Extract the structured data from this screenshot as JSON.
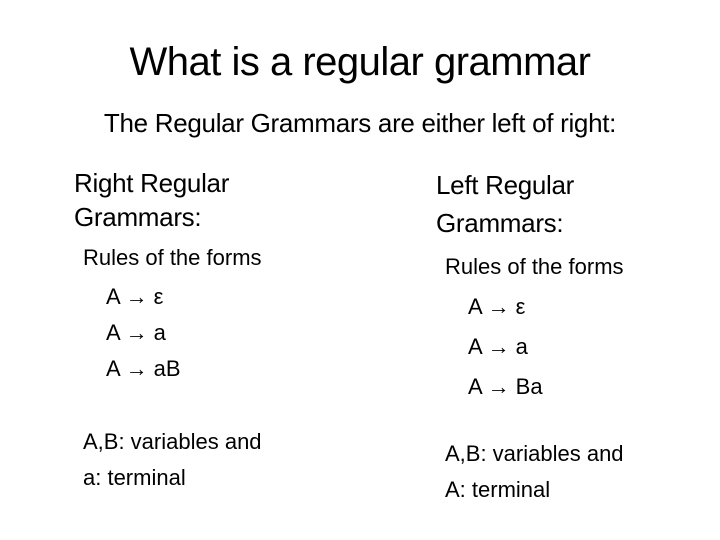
{
  "slide": {
    "title": "What is a regular grammar",
    "subtitle": "The Regular Grammars are either left of right:",
    "right_column": {
      "heading_line1": "Right Regular",
      "heading_line2": "Grammars:",
      "rules_label": "Rules of the forms",
      "rules": [
        "A → ε",
        "A → a",
        "A → aB"
      ],
      "note_line1": "A,B: variables and",
      "note_line2": "a: terminal"
    },
    "left_column": {
      "heading_line1": "Left Regular",
      "heading_line2": "Grammars:",
      "rules_label": "Rules of the forms",
      "rules": [
        "A → ε",
        "A → a",
        "A → Ba"
      ],
      "note_line1": "A,B: variables and",
      "note_line2": "A: terminal"
    }
  }
}
